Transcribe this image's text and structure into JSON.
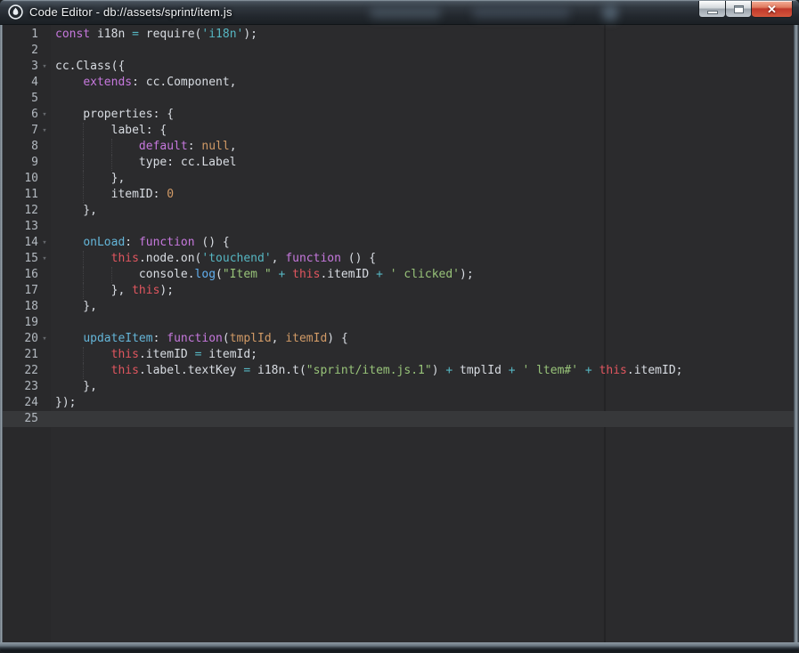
{
  "window": {
    "title": "Code Editor - db://assets/sprint/item.js",
    "app_icon": "cocos-creator-logo",
    "controls": [
      {
        "name": "minimize",
        "icon": "minimize-icon"
      },
      {
        "name": "maximize",
        "icon": "maximize-icon"
      },
      {
        "name": "close",
        "icon": "close-icon",
        "glyph": "✕"
      }
    ]
  },
  "colors": {
    "background": "#2b2b2d",
    "gutter_background": "#29292b",
    "current_line": "#37383a",
    "keyword": "#c678dd",
    "string_green": "#98c379",
    "string_cyan": "#56b6c2",
    "operator": "#56b6c2",
    "this_keyword": "#e0565f",
    "method_blue": "#61afef",
    "property_key": "#64b5d8",
    "number_orange": "#d19a66",
    "plain_text": "#d8dce2",
    "line_number": "#b3b9c0",
    "close_button": "#c0392b"
  },
  "editor": {
    "active_line": 25,
    "fold_marker": "▾",
    "lines": [
      {
        "n": 1,
        "fold": false,
        "guides": 0,
        "tokens": [
          [
            "kw",
            "const"
          ],
          [
            "pl",
            " i18n "
          ],
          [
            "op",
            "="
          ],
          [
            "pl",
            " require("
          ],
          [
            "sc",
            "'i18n'"
          ],
          [
            "pl",
            ");"
          ]
        ]
      },
      {
        "n": 2,
        "fold": false,
        "guides": 0,
        "tokens": []
      },
      {
        "n": 3,
        "fold": true,
        "guides": 0,
        "tokens": [
          [
            "pl",
            "cc.Class({"
          ]
        ]
      },
      {
        "n": 4,
        "fold": false,
        "guides": 0,
        "tokens": [
          [
            "pl",
            "    "
          ],
          [
            "kw",
            "extends"
          ],
          [
            "pl",
            ": cc.Component,"
          ]
        ]
      },
      {
        "n": 5,
        "fold": false,
        "guides": 0,
        "tokens": []
      },
      {
        "n": 6,
        "fold": true,
        "guides": 0,
        "tokens": [
          [
            "pl",
            "    properties: {"
          ]
        ]
      },
      {
        "n": 7,
        "fold": true,
        "guides": 1,
        "tokens": [
          [
            "pl",
            "        label: {"
          ]
        ]
      },
      {
        "n": 8,
        "fold": false,
        "guides": 2,
        "tokens": [
          [
            "pl",
            "            "
          ],
          [
            "kw",
            "default"
          ],
          [
            "pl",
            ": "
          ],
          [
            "num",
            "null"
          ],
          [
            "pl",
            ","
          ]
        ]
      },
      {
        "n": 9,
        "fold": false,
        "guides": 2,
        "tokens": [
          [
            "pl",
            "            type: cc.Label"
          ]
        ]
      },
      {
        "n": 10,
        "fold": false,
        "guides": 1,
        "tokens": [
          [
            "pl",
            "        },"
          ]
        ]
      },
      {
        "n": 11,
        "fold": false,
        "guides": 1,
        "tokens": [
          [
            "pl",
            "        itemID: "
          ],
          [
            "num",
            "0"
          ]
        ]
      },
      {
        "n": 12,
        "fold": false,
        "guides": 0,
        "tokens": [
          [
            "pl",
            "    },"
          ]
        ]
      },
      {
        "n": 13,
        "fold": false,
        "guides": 0,
        "tokens": []
      },
      {
        "n": 14,
        "fold": true,
        "guides": 0,
        "tokens": [
          [
            "pl",
            "    "
          ],
          [
            "key",
            "onLoad"
          ],
          [
            "pl",
            ": "
          ],
          [
            "kw",
            "function"
          ],
          [
            "pl",
            " () {"
          ]
        ]
      },
      {
        "n": 15,
        "fold": true,
        "guides": 1,
        "tokens": [
          [
            "pl",
            "        "
          ],
          [
            "th",
            "this"
          ],
          [
            "pl",
            ".node.on("
          ],
          [
            "sc",
            "'touchend'"
          ],
          [
            "pl",
            ", "
          ],
          [
            "kw",
            "function"
          ],
          [
            "pl",
            " () {"
          ]
        ]
      },
      {
        "n": 16,
        "fold": false,
        "guides": 2,
        "tokens": [
          [
            "pl",
            "            console."
          ],
          [
            "fn",
            "log"
          ],
          [
            "pl",
            "("
          ],
          [
            "sg",
            "\"Item \""
          ],
          [
            "pl",
            " "
          ],
          [
            "op",
            "+"
          ],
          [
            "pl",
            " "
          ],
          [
            "th",
            "this"
          ],
          [
            "pl",
            ".itemID "
          ],
          [
            "op",
            "+"
          ],
          [
            "pl",
            " "
          ],
          [
            "sg",
            "' clicked'"
          ],
          [
            "pl",
            ");"
          ]
        ]
      },
      {
        "n": 17,
        "fold": false,
        "guides": 1,
        "tokens": [
          [
            "pl",
            "        }, "
          ],
          [
            "th",
            "this"
          ],
          [
            "pl",
            ");"
          ]
        ]
      },
      {
        "n": 18,
        "fold": false,
        "guides": 0,
        "tokens": [
          [
            "pl",
            "    },"
          ]
        ]
      },
      {
        "n": 19,
        "fold": false,
        "guides": 0,
        "tokens": []
      },
      {
        "n": 20,
        "fold": true,
        "guides": 0,
        "tokens": [
          [
            "pl",
            "    "
          ],
          [
            "key",
            "updateItem"
          ],
          [
            "pl",
            ": "
          ],
          [
            "kw",
            "function"
          ],
          [
            "pl",
            "("
          ],
          [
            "param",
            "tmplId"
          ],
          [
            "pl",
            ", "
          ],
          [
            "param",
            "itemId"
          ],
          [
            "pl",
            ") {"
          ]
        ]
      },
      {
        "n": 21,
        "fold": false,
        "guides": 1,
        "tokens": [
          [
            "pl",
            "        "
          ],
          [
            "th",
            "this"
          ],
          [
            "pl",
            ".itemID "
          ],
          [
            "op",
            "="
          ],
          [
            "pl",
            " itemId;"
          ]
        ]
      },
      {
        "n": 22,
        "fold": false,
        "guides": 1,
        "tokens": [
          [
            "pl",
            "        "
          ],
          [
            "th",
            "this"
          ],
          [
            "pl",
            ".label.textKey "
          ],
          [
            "op",
            "="
          ],
          [
            "pl",
            " i18n.t("
          ],
          [
            "sg",
            "\"sprint/item.js.1\""
          ],
          [
            "pl",
            ") "
          ],
          [
            "op",
            "+"
          ],
          [
            "pl",
            " tmplId "
          ],
          [
            "op",
            "+"
          ],
          [
            "pl",
            " "
          ],
          [
            "sg",
            "' ltem#'"
          ],
          [
            "pl",
            " "
          ],
          [
            "op",
            "+"
          ],
          [
            "pl",
            " "
          ],
          [
            "th",
            "this"
          ],
          [
            "pl",
            ".itemID;"
          ]
        ]
      },
      {
        "n": 23,
        "fold": false,
        "guides": 0,
        "tokens": [
          [
            "pl",
            "    },"
          ]
        ]
      },
      {
        "n": 24,
        "fold": false,
        "guides": 0,
        "tokens": [
          [
            "pl",
            "});"
          ]
        ]
      },
      {
        "n": 25,
        "fold": false,
        "guides": 0,
        "tokens": []
      }
    ]
  }
}
